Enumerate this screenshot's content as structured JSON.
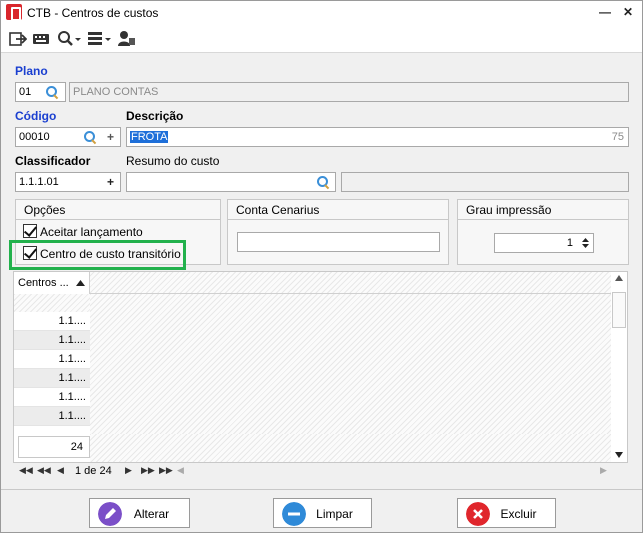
{
  "window": {
    "title": "CTB - Centros de custos"
  },
  "plano": {
    "label": "Plano",
    "code": "01",
    "name": "PLANO CONTAS"
  },
  "codigo": {
    "label": "Código",
    "value": "00010"
  },
  "descricao": {
    "label": "Descrição",
    "value": "FROTA",
    "counter": "75"
  },
  "classificador": {
    "label": "Classificador",
    "value": "1.1.1.01"
  },
  "resumo": {
    "label": "Resumo do custo",
    "value": ""
  },
  "opcoes": {
    "title": "Opções",
    "aceitar_label": "Aceitar lançamento",
    "aceitar_checked": true,
    "transitorio_label": "Centro de custo transitório",
    "transitorio_checked": true
  },
  "conta_cenarius": {
    "title": "Conta Cenarius",
    "value": ""
  },
  "grau_impressao": {
    "title": "Grau impressão",
    "value": "1"
  },
  "grid": {
    "column_header": "Centros ...",
    "rows": [
      "1.1....",
      "1.1....",
      "1.1....",
      "1.1....",
      "1.1....",
      "1.1...."
    ],
    "count": "24"
  },
  "pager": {
    "page_text": "1 de 24"
  },
  "buttons": {
    "alterar": "Alterar",
    "limpar": "Limpar",
    "excluir": "Excluir"
  },
  "colors": {
    "accent_blue": "#1a3fd0",
    "highlight_green": "#22b14c",
    "excluir_red": "#e0262c",
    "alterar_purple": "#7b4fc8",
    "limpar_blue": "#2f8ad8"
  }
}
